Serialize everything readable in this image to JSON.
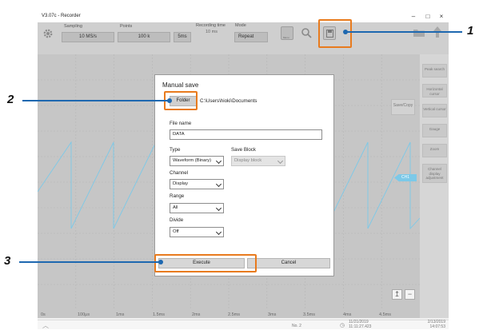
{
  "window": {
    "title": "V3.07c - Recorder",
    "controls": [
      "minimize",
      "maximize",
      "close"
    ]
  },
  "toolbar": {
    "sampling_label": "Sampling",
    "sampling_value": "10 MS/s",
    "points_label": "Points",
    "points_value": "100 k",
    "time_value": "5ms",
    "recording_time_label": "Recording time",
    "recording_time_value": "10 ms",
    "mode_label": "Mode",
    "mode_value": "Repeat",
    "small_btn_label": "Menu"
  },
  "right_panel": {
    "buttons": [
      "Peak search",
      "Horizontal cursor",
      "Vertical cursor",
      "Gauge",
      "Zoom",
      "Channel display adjustment"
    ]
  },
  "plot": {
    "save_copy_label": "Save/Copy",
    "marker_label": "CH1",
    "x_ticks": [
      "0s",
      "100μs",
      "1ms",
      "1.5ms",
      "2ms",
      "2.5ms",
      "3ms",
      "3.5ms",
      "4ms",
      "4.5ms"
    ]
  },
  "status": {
    "no_label": "No. 2",
    "time_center": "11/21/2019 11:11:27.423",
    "time_right": "2/13/2019 14:07:53"
  },
  "dialog": {
    "title": "Manual save",
    "folder_button": "Folder",
    "folder_path": "C:\\Users\\hioki\\Documents",
    "file_name_label": "File name",
    "file_name_value": "DATA",
    "type_label": "Type",
    "type_value": "Waveform (Binary)",
    "save_block_label": "Save Block",
    "save_block_value": "Display block",
    "channel_label": "Channel",
    "channel_value": "Display",
    "range_label": "Range",
    "range_value": "All",
    "divide_label": "Divide",
    "divide_value": "Off",
    "execute_button": "Execute",
    "cancel_button": "Cancel"
  },
  "callouts": [
    "1",
    "2",
    "3"
  ],
  "colors": {
    "highlight": "#e87b1e",
    "callout": "#1e68b0",
    "waveform": "#7cc9e8"
  }
}
